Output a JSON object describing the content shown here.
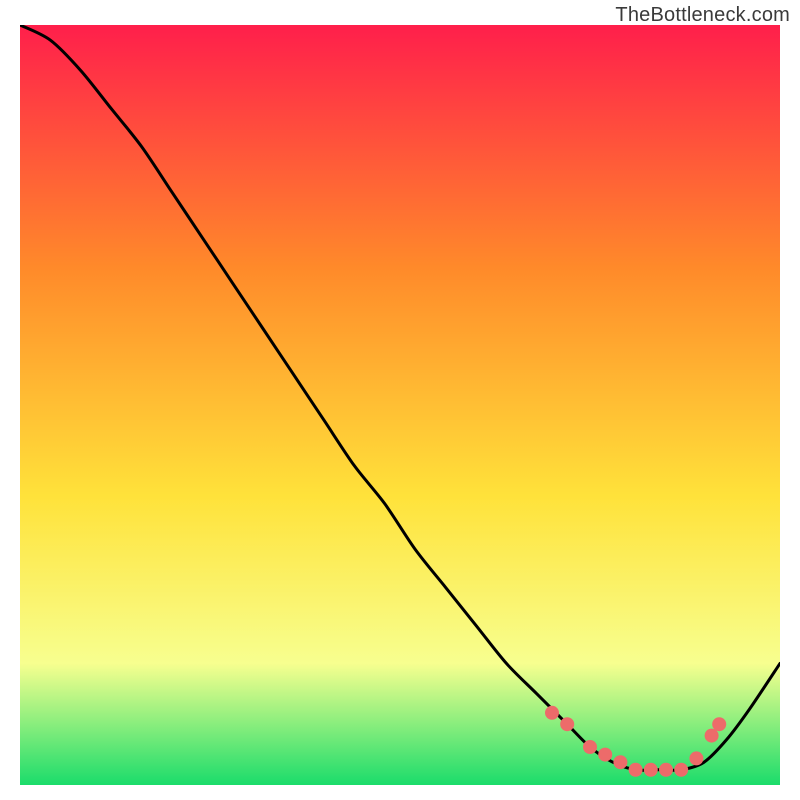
{
  "watermark": "TheBottleneck.com",
  "colors": {
    "gradient_top": "#ff1f4b",
    "gradient_mid1": "#ff8a2a",
    "gradient_mid2": "#ffe23a",
    "gradient_mid3": "#f7ff8f",
    "gradient_bottom": "#1bdc6b",
    "curve": "#000000",
    "dots": "#ed6b6a"
  },
  "chart_data": {
    "type": "line",
    "title": "",
    "xlabel": "",
    "ylabel": "",
    "xlim": [
      0,
      100
    ],
    "ylim": [
      0,
      100
    ],
    "series": [
      {
        "name": "bottleneck-curve",
        "x": [
          0,
          4,
          8,
          12,
          16,
          20,
          24,
          28,
          32,
          36,
          40,
          44,
          48,
          52,
          56,
          60,
          64,
          68,
          72,
          75,
          78,
          81,
          84,
          87,
          90,
          93,
          96,
          100
        ],
        "y": [
          100,
          98,
          94,
          89,
          84,
          78,
          72,
          66,
          60,
          54,
          48,
          42,
          37,
          31,
          26,
          21,
          16,
          12,
          8,
          5,
          3,
          2,
          2,
          2,
          3,
          6,
          10,
          16
        ]
      }
    ],
    "marker_points": {
      "name": "highlight-dots",
      "x": [
        70,
        72,
        75,
        77,
        79,
        81,
        83,
        85,
        87,
        89,
        91,
        92
      ],
      "y": [
        9.5,
        8,
        5,
        4,
        3,
        2,
        2,
        2,
        2,
        3.5,
        6.5,
        8
      ]
    }
  }
}
